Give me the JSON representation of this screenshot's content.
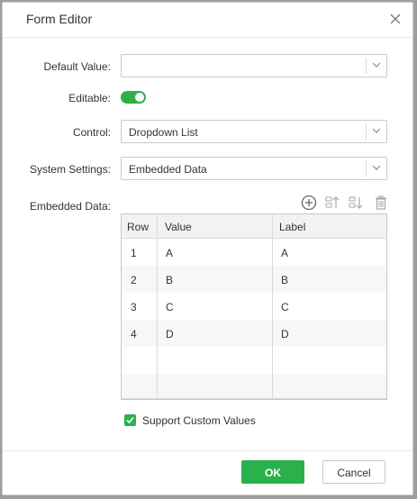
{
  "dialog": {
    "title": "Form Editor"
  },
  "fields": {
    "default_value": {
      "label": "Default Value:",
      "value": ""
    },
    "editable": {
      "label": "Editable:",
      "on": true
    },
    "control": {
      "label": "Control:",
      "value": "Dropdown List"
    },
    "system_settings": {
      "label": "System Settings:",
      "value": "Embedded Data"
    },
    "embedded_data": {
      "label": "Embedded Data:"
    }
  },
  "toolbar": {
    "icons": [
      "add-icon",
      "move-up-icon",
      "move-down-icon",
      "delete-icon"
    ]
  },
  "table": {
    "headers": [
      "Row",
      "Value",
      "Label"
    ],
    "rows": [
      {
        "row": "1",
        "value": "A",
        "label": "A"
      },
      {
        "row": "2",
        "value": "B",
        "label": "B"
      },
      {
        "row": "3",
        "value": "C",
        "label": "C"
      },
      {
        "row": "4",
        "value": "D",
        "label": "D"
      }
    ]
  },
  "options": {
    "support_custom_values": {
      "label": "Support Custom Values",
      "checked": true
    }
  },
  "footer": {
    "ok_label": "OK",
    "cancel_label": "Cancel"
  },
  "colors": {
    "accent": "#2bb14b"
  }
}
